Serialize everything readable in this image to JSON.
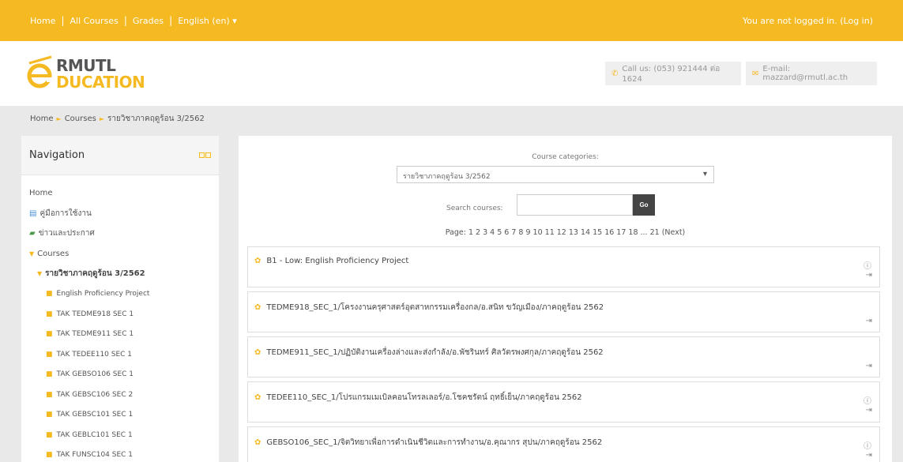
{
  "topbar": {
    "nav": [
      "Home",
      "All Courses",
      "Grades",
      "English (en)"
    ],
    "dropdown_caret": "▾",
    "login_text": "You are not logged in. (Log in)"
  },
  "header": {
    "logo_line1": "RMUTL",
    "logo_line2": "DUCATION",
    "call": "Call us: (053) 921444 ต่อ 1624",
    "email": "E-mail: mazzard@rmutl.ac.th"
  },
  "breadcrumb": [
    "Home",
    "Courses",
    "รายวิชาภาคฤดูร้อน 3/2562"
  ],
  "sidebar": {
    "title": "Navigation",
    "home": "Home",
    "manual": "คู่มือการใช้งาน",
    "news": "ข่าวและประกาศ",
    "courses": "Courses",
    "category": "รายวิชาภาคฤดูร้อน 3/2562",
    "course_items": [
      "English Proficiency Project",
      "TAK TEDME918 SEC 1",
      "TAK TEDME911 SEC 1",
      "TAK TEDEE110 SEC 1",
      "TAK GEBSO106 SEC 1",
      "TAK GEBSC106 SEC 2",
      "TAK GEBSC101 SEC 1",
      "TAK GEBLC101 SEC 1",
      "TAK FUNSC104 SEC 1"
    ]
  },
  "main": {
    "category_label": "Course categories:",
    "category_value": "รายวิชาภาคฤดูร้อน 3/2562",
    "search_label": "Search courses:",
    "search_value": "",
    "go_label": "Go",
    "paging": "Page: 1 2 3 4 5 6 7 8 9 10 11 12 13 14 15 16 17 18 ... 21 (Next)",
    "courses": [
      {
        "title": "B1 - Low: English Proficiency Project",
        "has_info": true
      },
      {
        "title": "TEDME918_SEC_1/โครงงานครุศาสตร์อุตสาหกรรมเครื่องกล/อ.สนิท ขวัญเมือง/ภาคฤดูร้อน 2562",
        "has_info": false
      },
      {
        "title": "TEDME911_SEC_1/ปฏิบัติงานเครื่องล่างและส่งกำลัง/อ.พัชรินทร์ ศิลวัตรพงศกุล/ภาคฤดูร้อน 2562",
        "has_info": false
      },
      {
        "title": "TEDEE110_SEC_1/โปรแกรมเมเบิลคอนโทรลเลอร์/อ.โชคชรัตน์ ฤทธิ์เย็น/ภาคฤดูร้อน 2562",
        "has_info": true
      },
      {
        "title": "GEBSO106_SEC_1/จิตวิทยาเพื่อการดำเนินชีวิตและการทำงาน/อ.คุณากร สุปน/ภาคฤดูร้อน 2562",
        "has_info": true
      }
    ]
  },
  "icons": {
    "info": "ⓘ",
    "enrol": "⇥",
    "phone": "✆",
    "mail": "✉",
    "breadcrumb_arrow": "►",
    "bullet": "■",
    "expanded": "▼",
    "course": "✿"
  },
  "colors": {
    "accent": "#f5b922",
    "go_button": "#444444"
  }
}
